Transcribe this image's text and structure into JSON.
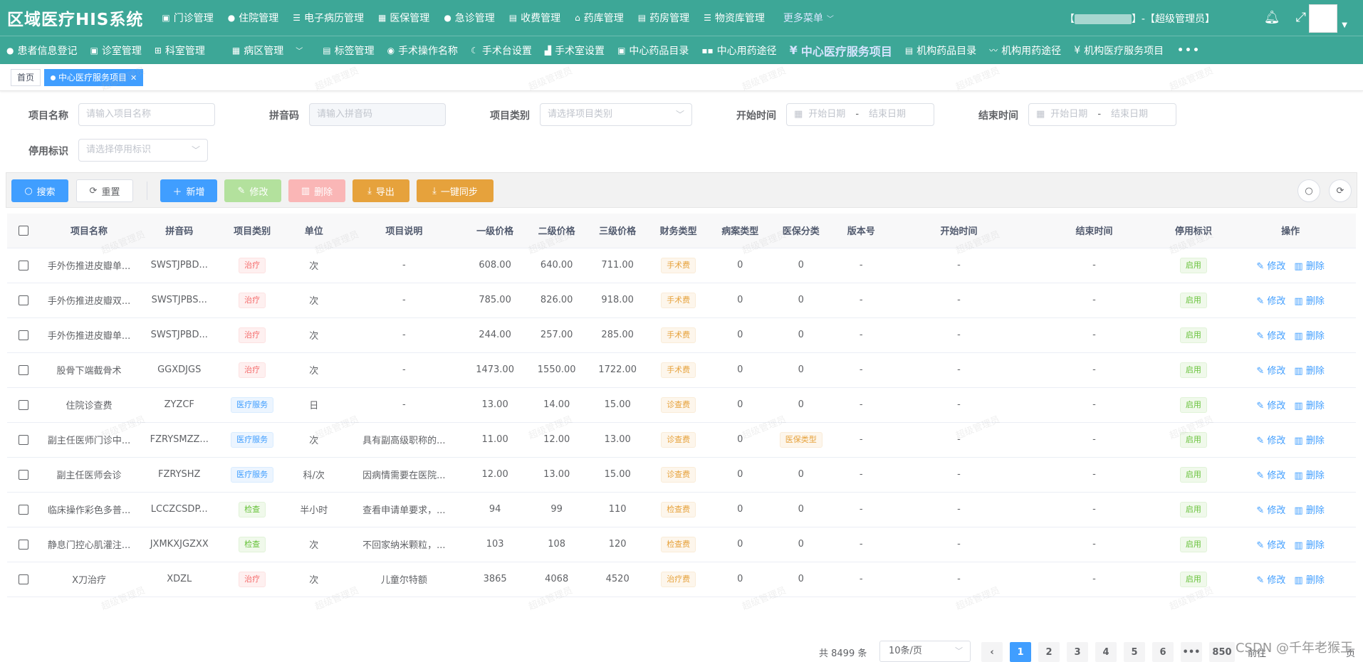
{
  "app": {
    "title": "区域医疗HIS系统"
  },
  "topnav": {
    "items": [
      {
        "label": "门诊管理",
        "icon": "briefcase-icon"
      },
      {
        "label": "住院管理",
        "icon": "user-icon"
      },
      {
        "label": "电子病历管理",
        "icon": "list-icon"
      },
      {
        "label": "医保管理",
        "icon": "building-icon"
      },
      {
        "label": "急诊管理",
        "icon": "user-icon"
      },
      {
        "label": "收费管理",
        "icon": "document-icon"
      },
      {
        "label": "药库管理",
        "icon": "home-icon"
      },
      {
        "label": "药房管理",
        "icon": "clipboard-icon"
      },
      {
        "label": "物资库管理",
        "icon": "list-icon"
      }
    ],
    "more": "更多菜单"
  },
  "user": {
    "role": "【超级管理员】"
  },
  "subnav": {
    "items": [
      {
        "label": "患者信息登记",
        "icon": "user-icon"
      },
      {
        "label": "诊室管理",
        "icon": "briefcase-icon"
      },
      {
        "label": "科室管理",
        "icon": "tree-icon"
      },
      {
        "label": "病区管理",
        "icon": "grid-icon"
      },
      {
        "label": "标签管理",
        "icon": "tag-icon"
      },
      {
        "label": "手术操作名称",
        "icon": "scalpel-icon"
      },
      {
        "label": "手术台设置",
        "icon": "leaf-icon"
      },
      {
        "label": "手术室设置",
        "icon": "room-icon"
      },
      {
        "label": "中心药品目录",
        "icon": "pill-icon"
      },
      {
        "label": "中心用药途径",
        "icon": "route-icon"
      },
      {
        "label": "中心医疗服务项目",
        "icon": "yen-icon",
        "active": true
      },
      {
        "label": "机构药品目录",
        "icon": "pill-icon"
      },
      {
        "label": "机构用药途径",
        "icon": "route-icon"
      },
      {
        "label": "机构医疗服务项目",
        "icon": "yen-icon"
      }
    ],
    "dots": "•••"
  },
  "tags": {
    "home": "首页",
    "current": "中心医疗服务项目"
  },
  "form": {
    "name_label": "项目名称",
    "name_placeholder": "请输入项目名称",
    "pinyin_label": "拼音码",
    "pinyin_placeholder": "请输入拼音码",
    "category_label": "项目类别",
    "category_placeholder": "请选择项目类别",
    "start_label": "开始时间",
    "end_label": "结束时间",
    "date_start_placeholder": "开始日期",
    "date_end_placeholder": "结束日期",
    "date_sep": "-",
    "stop_label": "停用标识",
    "stop_placeholder": "请选择停用标识"
  },
  "toolbar": {
    "search": "搜索",
    "reset": "重置",
    "add": "新增",
    "edit": "修改",
    "delete": "删除",
    "export": "导出",
    "sync": "一键同步"
  },
  "table": {
    "columns": [
      "项目名称",
      "拼音码",
      "项目类别",
      "单位",
      "项目说明",
      "一级价格",
      "二级价格",
      "三级价格",
      "财务类型",
      "病案类型",
      "医保分类",
      "版本号",
      "开始时间",
      "结束时间",
      "停用标识",
      "操作"
    ],
    "edit_label": "修改",
    "delete_label": "删除",
    "rows": [
      {
        "name": "手外伤推进皮瓣单...",
        "pinyin": "SWSTJPBD...",
        "category": "治疗",
        "cat_color": "red",
        "unit": "次",
        "desc": "-",
        "p1": "608.00",
        "p2": "640.00",
        "p3": "711.00",
        "finance": "手术费",
        "case": "0",
        "insurance": "0",
        "ins_tag": false,
        "version": "-",
        "start": "-",
        "end": "-",
        "stop": "启用"
      },
      {
        "name": "手外伤推进皮瓣双...",
        "pinyin": "SWSTJPBS...",
        "category": "治疗",
        "cat_color": "red",
        "unit": "次",
        "desc": "-",
        "p1": "785.00",
        "p2": "826.00",
        "p3": "918.00",
        "finance": "手术费",
        "case": "0",
        "insurance": "0",
        "ins_tag": false,
        "version": "-",
        "start": "-",
        "end": "-",
        "stop": "启用"
      },
      {
        "name": "手外伤推进皮瓣单...",
        "pinyin": "SWSTJPBD...",
        "category": "治疗",
        "cat_color": "red",
        "unit": "次",
        "desc": "-",
        "p1": "244.00",
        "p2": "257.00",
        "p3": "285.00",
        "finance": "手术费",
        "case": "0",
        "insurance": "0",
        "ins_tag": false,
        "version": "-",
        "start": "-",
        "end": "-",
        "stop": "启用"
      },
      {
        "name": "股骨下端截骨术",
        "pinyin": "GGXDJGS",
        "category": "治疗",
        "cat_color": "red",
        "unit": "次",
        "desc": "-",
        "p1": "1473.00",
        "p2": "1550.00",
        "p3": "1722.00",
        "finance": "手术费",
        "case": "0",
        "insurance": "0",
        "ins_tag": false,
        "version": "-",
        "start": "-",
        "end": "-",
        "stop": "启用"
      },
      {
        "name": "住院诊查费",
        "pinyin": "ZYZCF",
        "category": "医疗服务",
        "cat_color": "blue",
        "unit": "日",
        "desc": "-",
        "p1": "13.00",
        "p2": "14.00",
        "p3": "15.00",
        "finance": "诊查费",
        "case": "0",
        "insurance": "0",
        "ins_tag": false,
        "version": "-",
        "start": "-",
        "end": "-",
        "stop": "启用"
      },
      {
        "name": "副主任医师门诊中...",
        "pinyin": "FZRYSMZZ...",
        "category": "医疗服务",
        "cat_color": "blue",
        "unit": "次",
        "desc": "具有副高级职称的...",
        "p1": "11.00",
        "p2": "12.00",
        "p3": "13.00",
        "finance": "诊查费",
        "case": "0",
        "insurance": "医保类型",
        "ins_tag": true,
        "version": "-",
        "start": "-",
        "end": "-",
        "stop": "启用"
      },
      {
        "name": "副主任医师会诊",
        "pinyin": "FZRYSHZ",
        "category": "医疗服务",
        "cat_color": "blue",
        "unit": "科/次",
        "desc": "因病情需要在医院...",
        "p1": "12.00",
        "p2": "13.00",
        "p3": "15.00",
        "finance": "诊查费",
        "case": "0",
        "insurance": "0",
        "ins_tag": false,
        "version": "-",
        "start": "-",
        "end": "-",
        "stop": "启用"
      },
      {
        "name": "临床操作彩色多普...",
        "pinyin": "LCCZCSDP...",
        "category": "检查",
        "cat_color": "green",
        "unit": "半小时",
        "desc": "查看申请单要求，...",
        "p1": "94",
        "p2": "99",
        "p3": "110",
        "finance": "检查费",
        "case": "0",
        "insurance": "0",
        "ins_tag": false,
        "version": "-",
        "start": "-",
        "end": "-",
        "stop": "启用"
      },
      {
        "name": "静息门控心肌灌注...",
        "pinyin": "JXMKXJGZXX",
        "category": "检查",
        "cat_color": "green",
        "unit": "次",
        "desc": "不回家纳米颗粒，...",
        "p1": "103",
        "p2": "108",
        "p3": "120",
        "finance": "检查费",
        "case": "0",
        "insurance": "0",
        "ins_tag": false,
        "version": "-",
        "start": "-",
        "end": "-",
        "stop": "启用"
      },
      {
        "name": "X刀治疗",
        "pinyin": "XDZL",
        "category": "治疗",
        "cat_color": "red",
        "unit": "次",
        "desc": "儿童尔特额",
        "p1": "3865",
        "p2": "4068",
        "p3": "4520",
        "finance": "治疗费",
        "case": "0",
        "insurance": "0",
        "ins_tag": false,
        "version": "-",
        "start": "-",
        "end": "-",
        "stop": "启用"
      }
    ]
  },
  "pagination": {
    "total": "共 8499 条",
    "page_size": "10条/页",
    "pages": [
      "1",
      "2",
      "3",
      "4",
      "5",
      "6"
    ],
    "ellipsis": "•••",
    "last": "850",
    "prev": "‹",
    "goto": "前往",
    "unit": "页"
  },
  "watermark": "超级管理员",
  "footer_credit": "CSDN @千年老猴王"
}
